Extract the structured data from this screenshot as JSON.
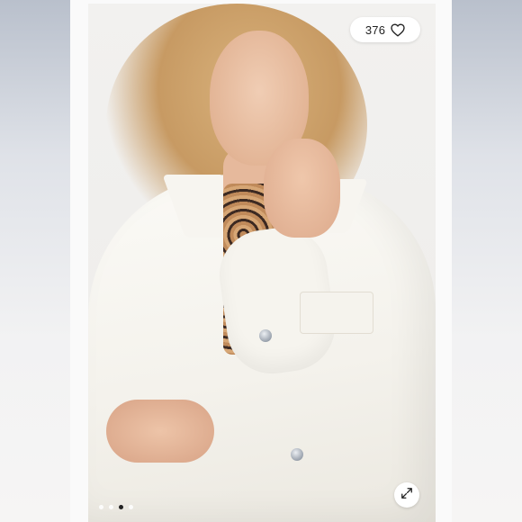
{
  "listing": {
    "like_count": "376",
    "icons": {
      "like": "heart-outline-icon",
      "expand": "expand-diagonal-arrows-icon"
    },
    "carousel": {
      "total_slides": 4,
      "active_index": 2
    }
  },
  "colors": {
    "pill_background": "#ffffff",
    "text": "#222222",
    "active_dot": "#222222",
    "inactive_dot": "#ffffff"
  }
}
